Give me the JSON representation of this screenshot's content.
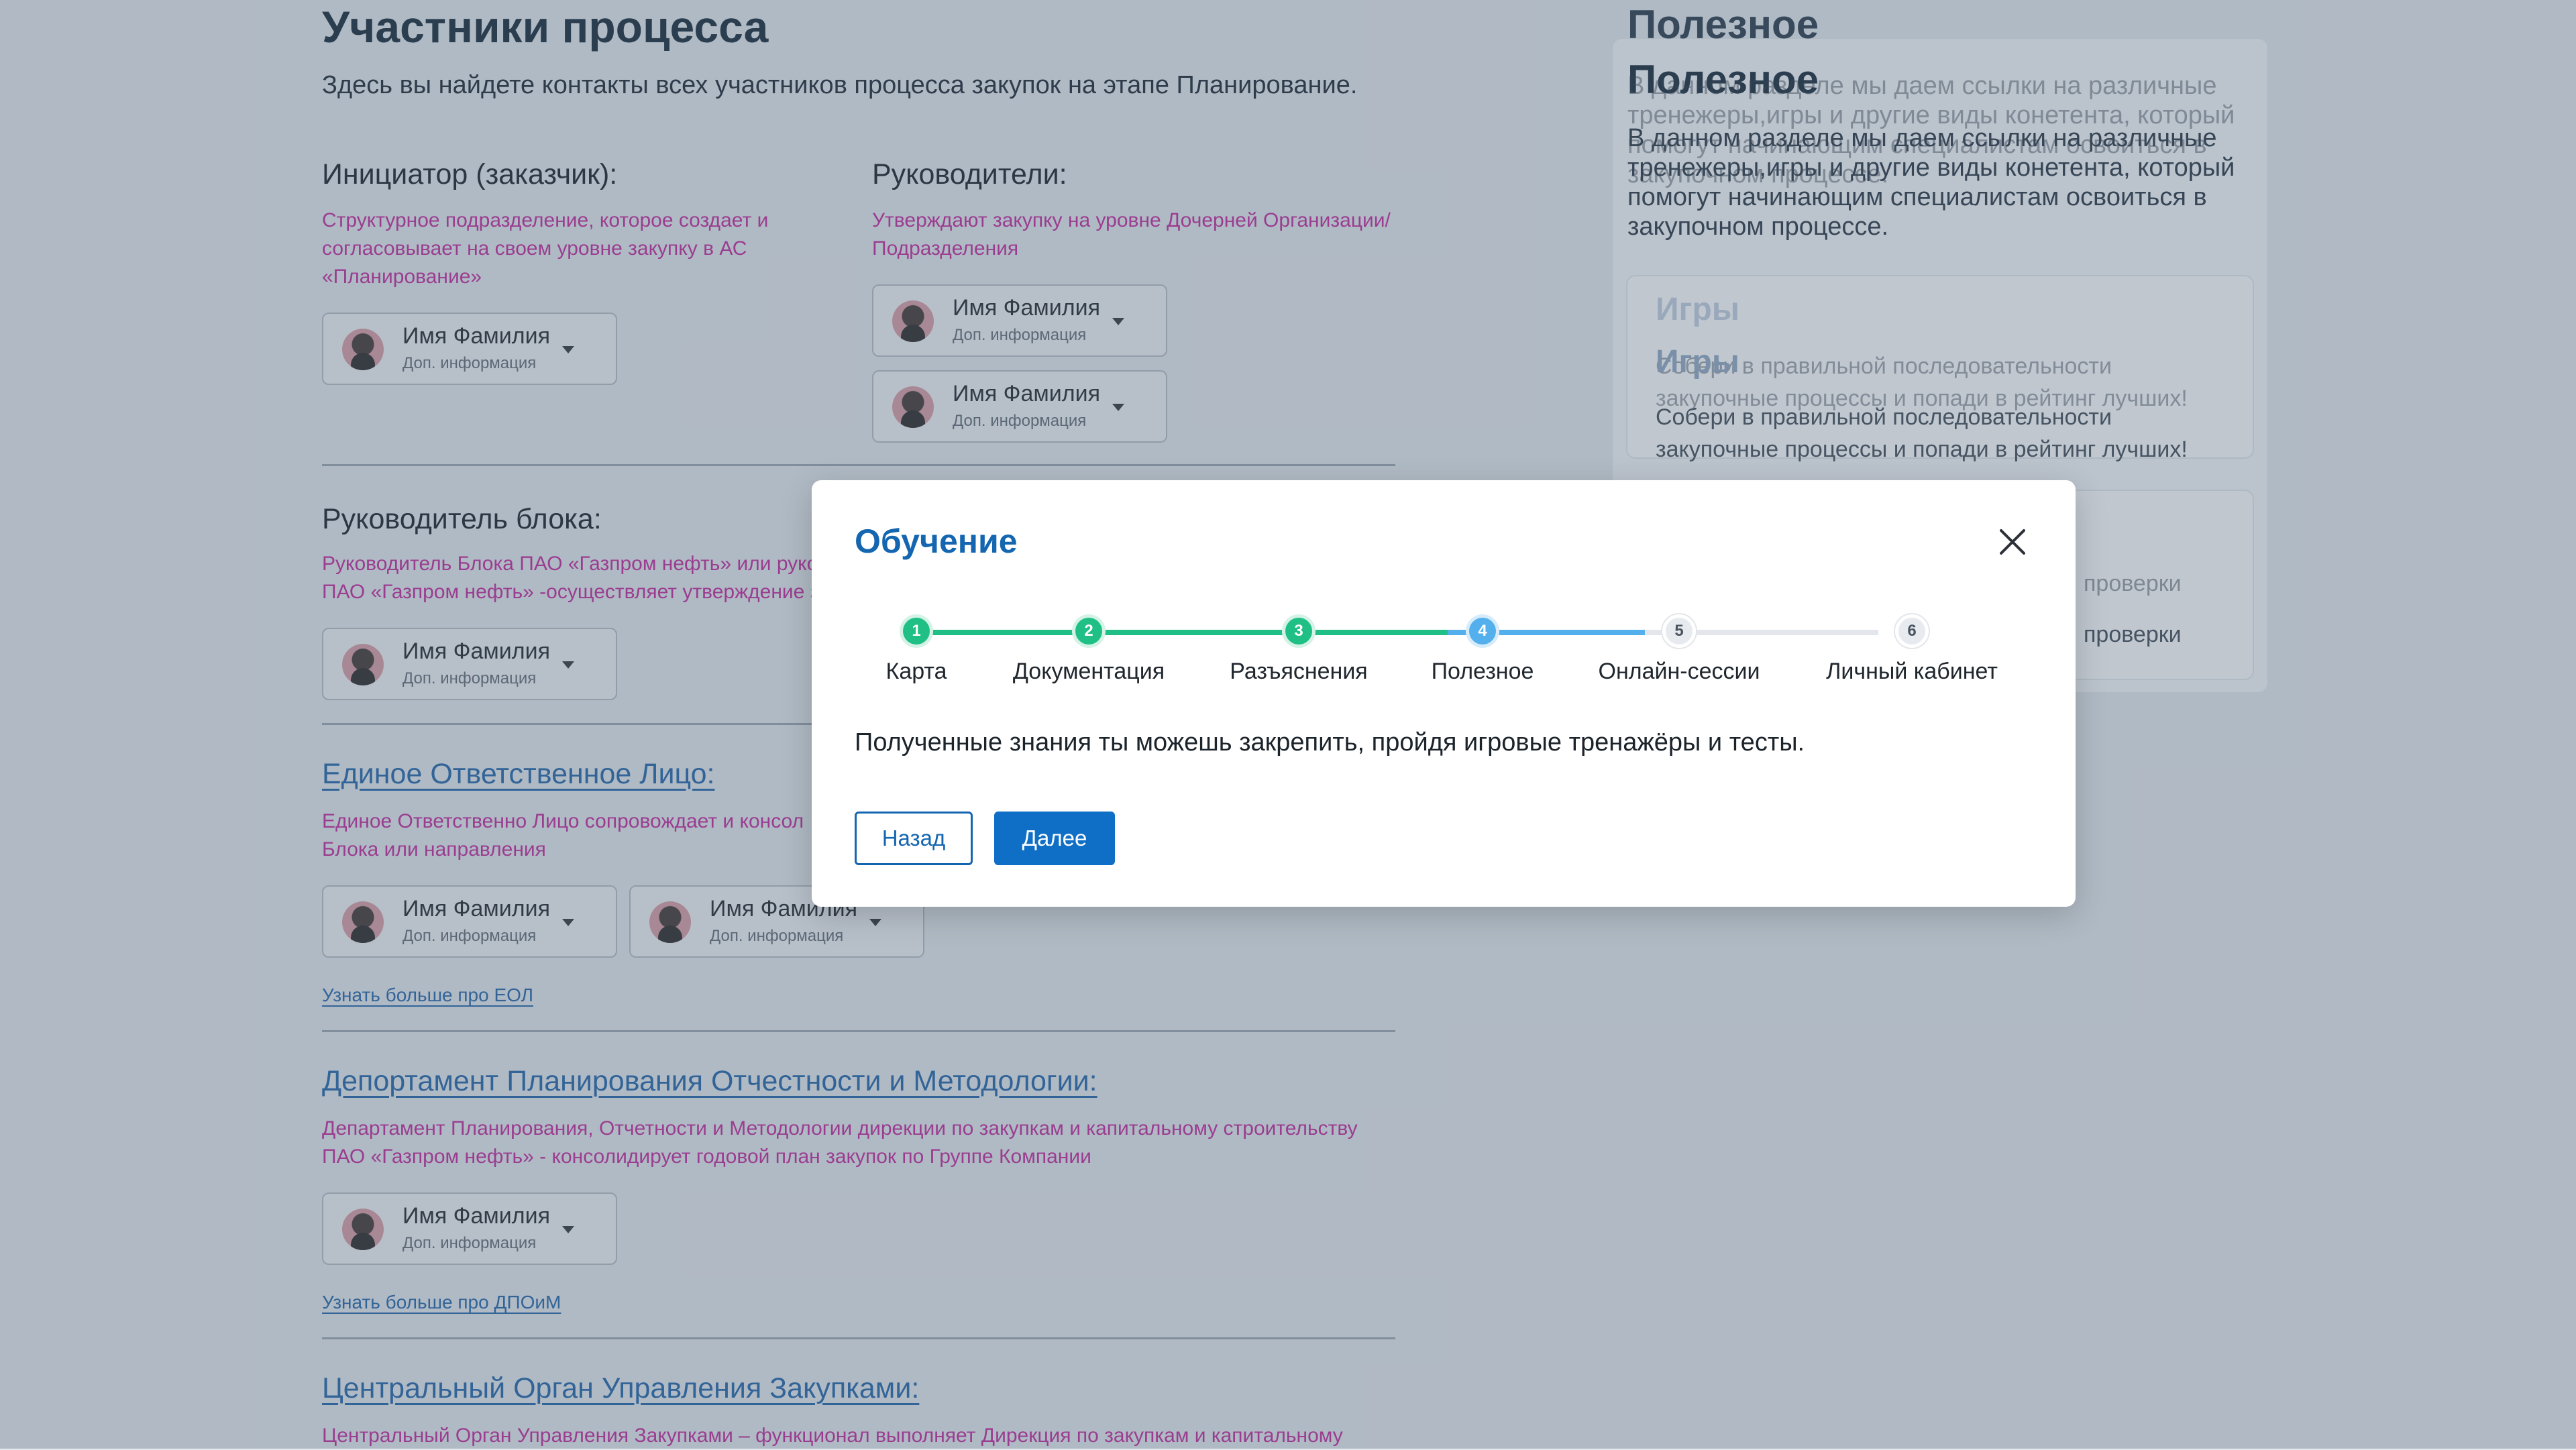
{
  "page": {
    "title": "Участники процесса",
    "intro": "Здесь вы найдете контакты всех участников процесса закупок на этапе Планирование."
  },
  "sections": {
    "initiator": {
      "title": "Инициатор (заказчик):",
      "desc_l1": "Структурное подразделение, которое создает и",
      "desc_l2": "согласовывает на своем уровне закупку в АС",
      "desc_l3": "«Планирование»"
    },
    "managers": {
      "title": "Руководители:",
      "desc_l1": "Утверждают закупку на уровне Дочерней Организации/",
      "desc_l2": "Подразделения"
    },
    "block_head": {
      "title": "Руководитель блока:",
      "desc_l1": "Руководитель Блока ПАО «Газпром нефть» или руков",
      "desc_l2": "ПАО «Газпром нефть» -осуществляет утверждение з"
    },
    "eol": {
      "title": "Единое Ответственное Лицо:",
      "desc_l1": "Единое Ответственно Лицо сопровождает и консол",
      "desc_l2": "Блока или направления",
      "more": "Узнать больше про ЕОЛ"
    },
    "dpoim": {
      "title": "Депортамент Планирования Отчестности и Методологии:",
      "desc_l1": "Департамент Планирования, Отчетности и Методологии дирекции по закупкам и капитальному строительству",
      "desc_l2": "ПАО «Газпром нефть» - консолидирует годовой план закупок по Группе Компании",
      "more": "Узнать больше про ДПОиМ"
    },
    "central": {
      "title": "Центральный Орган Управления Закупками:",
      "desc_l1": "Центральный Орган Управления Закупками – функционал выполняет Дирекция по закупкам и капитальному"
    }
  },
  "person": {
    "name": "Имя Фамилия",
    "info": "Доп. информация"
  },
  "side": {
    "title": "Полезное",
    "text_l1": "В данном разделе мы даем ссылки на различные",
    "text_l2": "тренежеры,игры и другие виды конетента, который",
    "text_l3": "помогут начинающим специалистам освоиться в",
    "text_l4": "закупочном процессе.",
    "games_title": "Игры",
    "games_l1": "Собери в правильной последовательности",
    "games_l2": "закупочные процессы и попади в рейтинг лучших!",
    "check_text": "проверки"
  },
  "modal": {
    "title": "Обучение",
    "steps": [
      {
        "num": "1",
        "label": "Карта",
        "state": "done"
      },
      {
        "num": "2",
        "label": "Документация",
        "state": "done"
      },
      {
        "num": "3",
        "label": "Разъяснения",
        "state": "done"
      },
      {
        "num": "4",
        "label": "Полезное",
        "state": "current"
      },
      {
        "num": "5",
        "label": "Онлайн-сессии",
        "state": "todo"
      },
      {
        "num": "6",
        "label": "Личный кабинет",
        "state": "todo"
      }
    ],
    "body": "Полученные знания ты можешь закрепить, пройдя игровые тренажёры и тесты.",
    "back_label": "Назад",
    "next_label": "Далее"
  },
  "colors": {
    "accent": "#1466b0",
    "done": "#1fbf86",
    "current": "#54b0ec",
    "description": "#c2219a"
  }
}
